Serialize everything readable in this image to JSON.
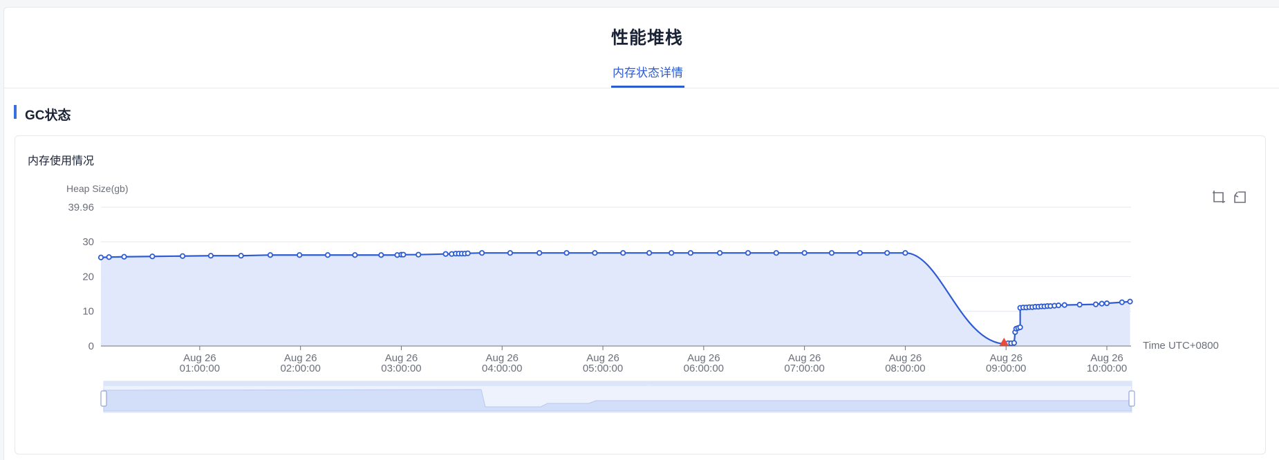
{
  "header": {
    "title": "性能堆栈",
    "tab_label": "内存状态详情"
  },
  "section": {
    "title": "GC状态"
  },
  "card": {
    "title": "内存使用情况"
  },
  "toolbox": {
    "zoom_icon": "zoom-select-icon",
    "restore_icon": "zoom-restore-icon"
  },
  "colors": {
    "line": "#2d5bd2",
    "area": "#dfe7fb",
    "accent": "#2d5bd2",
    "marker_highlight": "#e84c3d"
  },
  "chart_data": {
    "type": "line",
    "ylabel": "Heap Size(gb)",
    "xlabel": "Time UTC+0800",
    "ylim": [
      0,
      39.96
    ],
    "y_ticks": [
      {
        "value": 0,
        "label": "0"
      },
      {
        "value": 10,
        "label": "10"
      },
      {
        "value": 20,
        "label": "20"
      },
      {
        "value": 30,
        "label": "30"
      },
      {
        "value": 39.96,
        "label": "39.96"
      }
    ],
    "x_ticks": [
      {
        "t": 1.0,
        "line1": "Aug 26",
        "line2": "01:00:00"
      },
      {
        "t": 2.0,
        "line1": "Aug 26",
        "line2": "02:00:00"
      },
      {
        "t": 3.0,
        "line1": "Aug 26",
        "line2": "03:00:00"
      },
      {
        "t": 4.0,
        "line1": "Aug 26",
        "line2": "04:00:00"
      },
      {
        "t": 5.0,
        "line1": "Aug 26",
        "line2": "05:00:00"
      },
      {
        "t": 6.0,
        "line1": "Aug 26",
        "line2": "06:00:00"
      },
      {
        "t": 7.0,
        "line1": "Aug 26",
        "line2": "07:00:00"
      },
      {
        "t": 8.0,
        "line1": "Aug 26",
        "line2": "08:00:00"
      },
      {
        "t": 9.0,
        "line1": "Aug 26",
        "line2": "09:00:00"
      },
      {
        "t": 10.0,
        "line1": "Aug 26",
        "line2": "10:00:00"
      }
    ],
    "xlim": [
      0.02,
      10.24
    ],
    "x_unit": "hours since Aug 26 00:00",
    "grid": true,
    "series": [
      {
        "points": [
          [
            0.02,
            25.5
          ],
          [
            0.1,
            25.6
          ],
          [
            0.25,
            25.7
          ],
          [
            0.53,
            25.8
          ],
          [
            0.83,
            25.9
          ],
          [
            1.11,
            26.0
          ],
          [
            1.41,
            26.0
          ],
          [
            1.7,
            26.2
          ],
          [
            1.99,
            26.2
          ],
          [
            2.27,
            26.2
          ],
          [
            2.54,
            26.2
          ],
          [
            2.8,
            26.2
          ],
          [
            2.96,
            26.2
          ],
          [
            3.0,
            26.3
          ],
          [
            3.02,
            26.3
          ],
          [
            3.17,
            26.3
          ],
          [
            3.44,
            26.5
          ],
          [
            3.5,
            26.5
          ],
          [
            3.54,
            26.6
          ],
          [
            3.57,
            26.6
          ],
          [
            3.6,
            26.6
          ],
          [
            3.63,
            26.6
          ],
          [
            3.66,
            26.7
          ],
          [
            3.8,
            26.8
          ],
          [
            4.08,
            26.8
          ],
          [
            4.37,
            26.8
          ],
          [
            4.64,
            26.8
          ],
          [
            4.92,
            26.8
          ],
          [
            5.2,
            26.8
          ],
          [
            5.46,
            26.8
          ],
          [
            5.68,
            26.8
          ],
          [
            5.87,
            26.8
          ],
          [
            6.16,
            26.8
          ],
          [
            6.44,
            26.8
          ],
          [
            6.72,
            26.8
          ],
          [
            7.0,
            26.8
          ],
          [
            7.27,
            26.8
          ],
          [
            7.55,
            26.8
          ],
          [
            7.82,
            26.8
          ],
          [
            8.0,
            26.8
          ],
          [
            9.0,
            0.6
          ],
          [
            9.02,
            0.8
          ],
          [
            9.05,
            0.8
          ],
          [
            9.08,
            0.9
          ],
          [
            9.09,
            4.0
          ],
          [
            9.1,
            5.0
          ],
          [
            9.12,
            5.2
          ],
          [
            9.14,
            5.4
          ],
          [
            9.14,
            11.0
          ],
          [
            9.17,
            11.1
          ],
          [
            9.2,
            11.1
          ],
          [
            9.23,
            11.2
          ],
          [
            9.26,
            11.2
          ],
          [
            9.29,
            11.3
          ],
          [
            9.32,
            11.3
          ],
          [
            9.35,
            11.4
          ],
          [
            9.38,
            11.4
          ],
          [
            9.41,
            11.5
          ],
          [
            9.44,
            11.5
          ],
          [
            9.48,
            11.6
          ],
          [
            9.52,
            11.7
          ],
          [
            9.58,
            11.8
          ],
          [
            9.73,
            11.9
          ],
          [
            9.89,
            12.0
          ],
          [
            9.95,
            12.2
          ],
          [
            10.0,
            12.3
          ],
          [
            10.15,
            12.6
          ],
          [
            10.23,
            12.8
          ]
        ]
      }
    ],
    "highlight_t": 8.98,
    "datazoom": {
      "start_percent": 0,
      "end_percent": 100
    }
  }
}
